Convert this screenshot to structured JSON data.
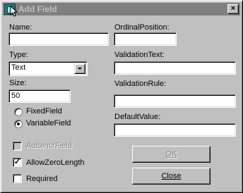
{
  "window": {
    "title": "Add Field",
    "close_glyph": "×",
    "icon": "app-icon"
  },
  "left": {
    "name_label": "Name:",
    "name_value": "",
    "type_label": "Type:",
    "type_value": "Text",
    "size_label": "Size:",
    "size_value": "50",
    "fixed_label": "FixedField",
    "variable_label": "VariableField",
    "selected_field_kind": "VariableField",
    "autoincr_label": "AutoIncrField",
    "allowzero_label": "AllowZeroLength",
    "allowzero_checked": true,
    "required_label": "Required",
    "required_checked": false
  },
  "right": {
    "ordinal_label": "OrdinalPosition:",
    "ordinal_value": "",
    "validation_text_label": "ValidationText:",
    "validation_text_value": "",
    "validation_rule_label": "ValidationRule:",
    "validation_rule_value": "",
    "default_value_label": "DefaultValue:",
    "default_value_value": ""
  },
  "buttons": {
    "ok_label": "OK",
    "close_label": "Close"
  },
  "check_glyph": "✓"
}
